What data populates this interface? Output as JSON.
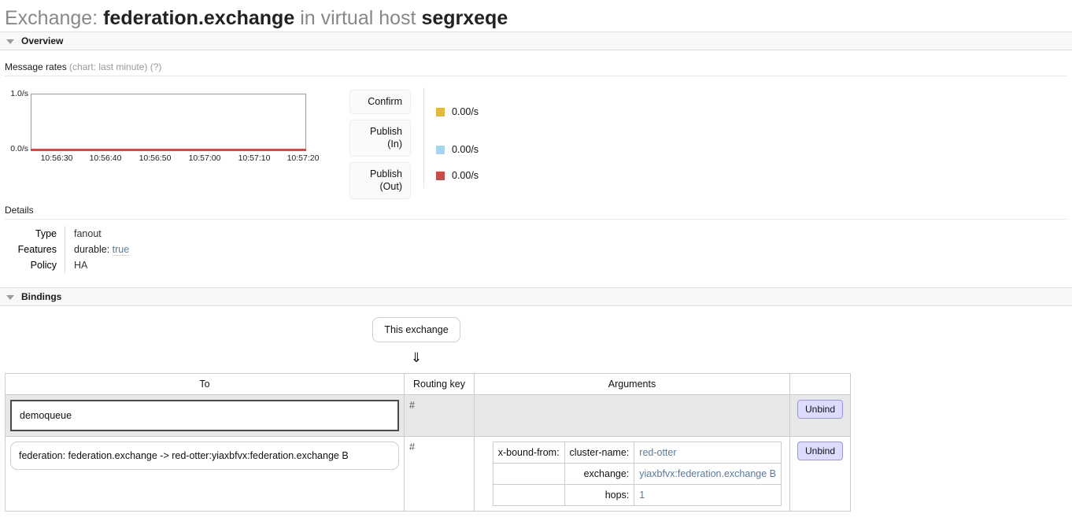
{
  "page": {
    "title_prefix": "Exchange:",
    "exchange_name": "federation.exchange",
    "title_mid": "in virtual host",
    "vhost": "segrxeqe"
  },
  "overview": {
    "section_label": "Overview",
    "message_rates_label": "Message rates",
    "message_rates_note": "(chart: last minute) (?)"
  },
  "chart_data": {
    "type": "line",
    "title": "Message rates",
    "subtitle": "(chart: last minute) (?)",
    "xlabel": "",
    "ylabel": "",
    "ylim": [
      0.0,
      1.0
    ],
    "y_ticks": [
      "0.0/s",
      "1.0/s"
    ],
    "x_ticks": [
      "10:56:30",
      "10:56:40",
      "10:56:50",
      "10:57:00",
      "10:57:10",
      "10:57:20"
    ],
    "grid": false,
    "legend_position": "right",
    "series": [
      {
        "name": "Confirm",
        "color": "#e3b93c",
        "rate_label": "0.00/s",
        "values": [
          0,
          0,
          0,
          0,
          0,
          0
        ]
      },
      {
        "name": "Publish (In)",
        "color": "#a7d6f0",
        "rate_label": "0.00/s",
        "values": [
          0,
          0,
          0,
          0,
          0,
          0
        ]
      },
      {
        "name": "Publish (Out)",
        "color": "#cc4b4b",
        "rate_label": "0.00/s",
        "values": [
          0,
          0,
          0,
          0,
          0,
          0
        ]
      }
    ]
  },
  "metric_buttons": [
    {
      "label": "Confirm"
    },
    {
      "label": "Publish\n(In)",
      "line1": "Publish",
      "line2": "(In)"
    },
    {
      "label": "Publish\n(Out)",
      "line1": "Publish",
      "line2": "(Out)"
    }
  ],
  "details": {
    "label": "Details",
    "rows": [
      {
        "key": "Type",
        "value": "fanout"
      },
      {
        "key": "Features",
        "kv_key": "durable:",
        "kv_value": "true"
      },
      {
        "key": "Policy",
        "value": "HA"
      }
    ]
  },
  "bindings": {
    "section_label": "Bindings",
    "this_exchange_label": "This exchange",
    "arrow": "⇓",
    "columns": [
      "To",
      "Routing key",
      "Arguments",
      ""
    ],
    "rows": [
      {
        "to": "demoqueue",
        "to_type": "queue",
        "routing_key": "#",
        "arguments": [],
        "action_label": "Unbind"
      },
      {
        "to": "federation: federation.exchange -> red-otter:yiaxbfvx:federation.exchange B",
        "to_type": "exchange",
        "routing_key": "#",
        "arguments": [
          {
            "lead": "x-bound-from:",
            "key": "cluster-name:",
            "value": "red-otter"
          },
          {
            "lead": "",
            "key": "exchange:",
            "value": "yiaxbfvx:federation.exchange B"
          },
          {
            "lead": "",
            "key": "hops:",
            "value": "1"
          }
        ],
        "action_label": "Unbind"
      }
    ]
  }
}
